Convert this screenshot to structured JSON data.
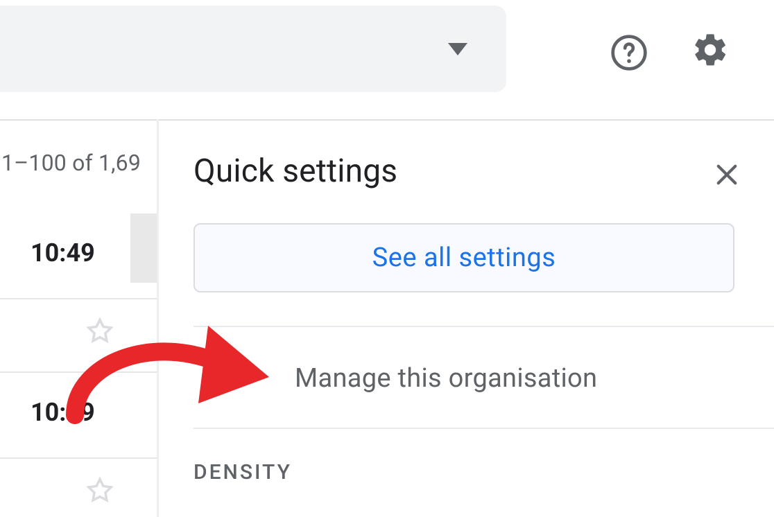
{
  "header": {
    "pager_text": "1–100 of 1,69"
  },
  "list": {
    "row1_time": "10:49",
    "row2_time": "10:49"
  },
  "panel": {
    "title": "Quick settings",
    "see_all_label": "See all settings",
    "manage_org_label": "Manage this organisation",
    "density_heading": "DENSITY"
  },
  "annotation": {
    "color": "#e8272a"
  }
}
